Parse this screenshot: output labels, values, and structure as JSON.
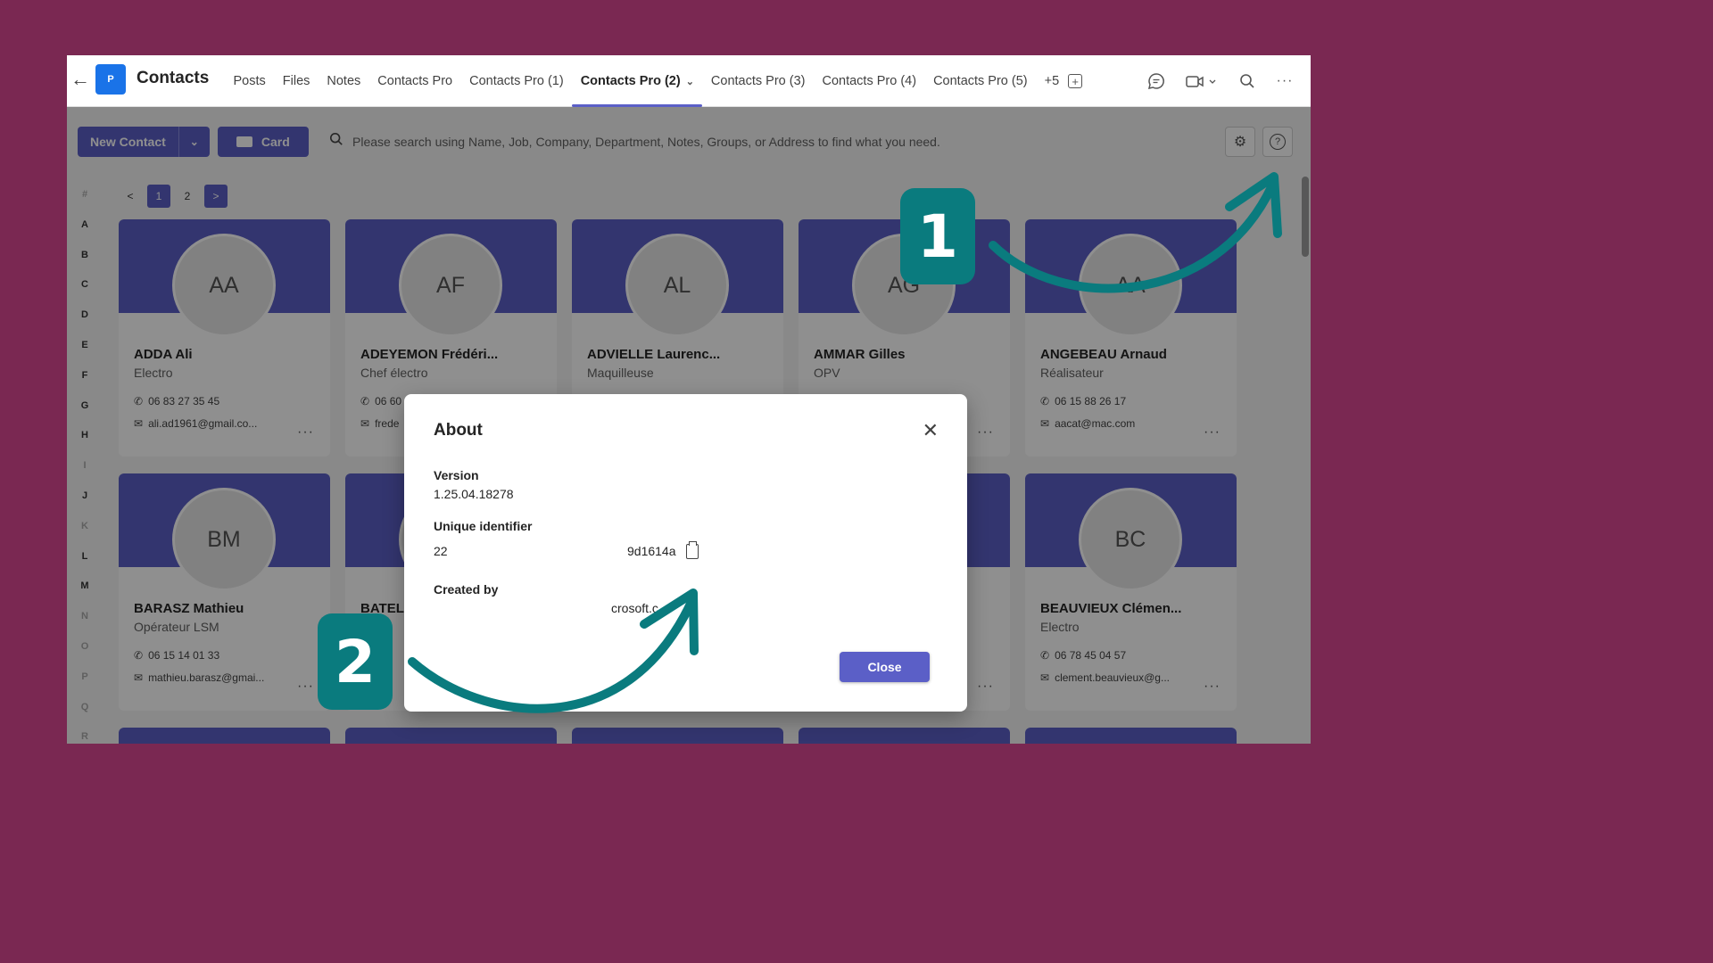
{
  "topbar": {
    "app_logo": "P",
    "app_title": "Contacts",
    "tabs": [
      {
        "label": "Posts"
      },
      {
        "label": "Files"
      },
      {
        "label": "Notes"
      },
      {
        "label": "Contacts Pro"
      },
      {
        "label": "Contacts Pro (1)"
      },
      {
        "label": "Contacts Pro (2)",
        "active": true
      },
      {
        "label": "Contacts Pro (3)"
      },
      {
        "label": "Contacts Pro (4)"
      },
      {
        "label": "Contacts Pro (5)"
      },
      {
        "label": "+5"
      }
    ]
  },
  "toolbar": {
    "new_contact_label": "New Contact",
    "card_label": "Card",
    "search_placeholder": "Please search using Name, Job, Company, Department, Notes, Groups, or Address to find what you need."
  },
  "alphabet": [
    "#",
    "A",
    "B",
    "C",
    "D",
    "E",
    "F",
    "G",
    "H",
    "I",
    "J",
    "K",
    "L",
    "M",
    "N",
    "O",
    "P",
    "Q",
    "R"
  ],
  "pager": {
    "prev": "<",
    "pages": [
      "1",
      "2"
    ],
    "next": ">",
    "current": "1"
  },
  "contacts": [
    {
      "initials": "AA",
      "name": "ADDA Ali",
      "job": "Electro",
      "phone": "06 83 27 35 45",
      "email": "ali.ad1961@gmail.co..."
    },
    {
      "initials": "AF",
      "name": "ADEYEMON Frédéri...",
      "job": "Chef électro",
      "phone": "06 60",
      "email": "frede"
    },
    {
      "initials": "AL",
      "name": "ADVIELLE Laurenc...",
      "job": "Maquilleuse",
      "phone": "",
      "email": ""
    },
    {
      "initials": "AG",
      "name": "AMMAR Gilles",
      "job": "OPV",
      "phone": "",
      "email": ""
    },
    {
      "initials": "AA",
      "name": "ANGEBEAU Arnaud",
      "job": "Réalisateur",
      "phone": "06 15 88 26 17",
      "email": "aacat@mac.com"
    },
    {
      "initials": "BM",
      "name": "BARASZ Mathieu",
      "job": "Opérateur LSM",
      "phone": "06 15 14 01 33",
      "email": "mathieu.barasz@gmai..."
    },
    {
      "initials": "",
      "name": "BATEL",
      "job": "",
      "phone": "",
      "email": ""
    },
    {
      "initials": "",
      "name": "",
      "job": "",
      "phone": "",
      "email": ""
    },
    {
      "initials": "",
      "name": "",
      "job": "",
      "phone": "",
      "email": ""
    },
    {
      "initials": "BC",
      "name": "BEAUVIEUX Clémen...",
      "job": "Electro",
      "phone": "06 78 45 04 57",
      "email": "clement.beauvieux@g..."
    }
  ],
  "modal": {
    "title": "About",
    "version_label": "Version",
    "version_value": "1.25.04.18278",
    "uid_label": "Unique identifier",
    "uid_prefix": "22",
    "uid_suffix": "9d1614a",
    "created_label": "Created by",
    "created_value": "crosoft.c",
    "close_label": "Close"
  },
  "annotations": {
    "badge1": "1",
    "badge2": "2",
    "color": "#0a7b7e"
  },
  "colors": {
    "accent": "#5b5fc7",
    "background": "#7a2852"
  }
}
